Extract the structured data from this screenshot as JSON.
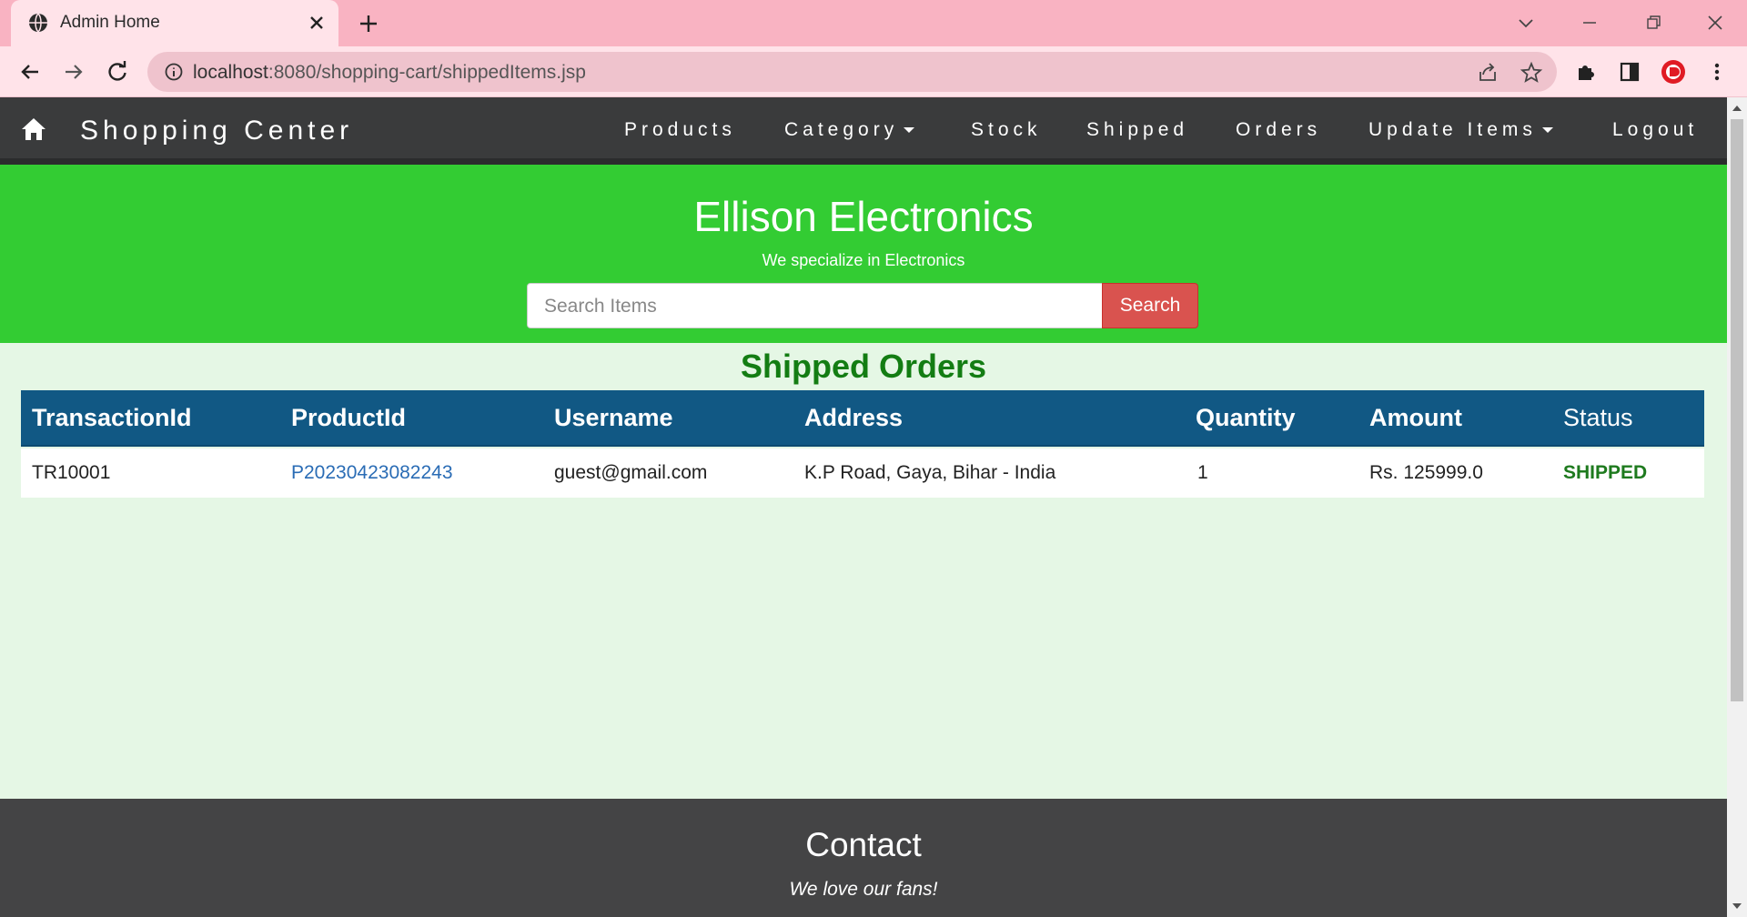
{
  "browser": {
    "tab_title": "Admin Home",
    "url_host": "localhost",
    "url_rest": ":8080/shopping-cart/shippedItems.jsp"
  },
  "navbar": {
    "brand": "Shopping Center",
    "items": [
      {
        "label": "Products"
      },
      {
        "label": "Category"
      },
      {
        "label": "Stock"
      },
      {
        "label": "Shipped"
      },
      {
        "label": "Orders"
      },
      {
        "label": "Update Items"
      },
      {
        "label": "Logout"
      }
    ]
  },
  "header": {
    "title": "Ellison Electronics",
    "subtitle": "We specialize in Electronics",
    "search_placeholder": "Search Items",
    "search_button": "Search"
  },
  "section": {
    "title": "Shipped Orders"
  },
  "table": {
    "columns": [
      "TransactionId",
      "ProductId",
      "Username",
      "Address",
      "Quantity",
      "Amount",
      "Status"
    ],
    "rows": [
      {
        "transaction_id": "TR10001",
        "product_id": "P20230423082243",
        "username": "guest@gmail.com",
        "address": "K.P Road, Gaya, Bihar - India",
        "quantity": "1",
        "amount": "Rs. 125999.0",
        "status": "SHIPPED"
      }
    ]
  },
  "footer": {
    "title": "Contact",
    "subtitle": "We love our fans!"
  },
  "colors": {
    "navbar": "#3a3b3c",
    "jumbotron": "#33cc33",
    "table_header": "#115884",
    "search_button": "#d9534f",
    "section_title": "#137d13",
    "status_text": "#1e7a1e"
  }
}
